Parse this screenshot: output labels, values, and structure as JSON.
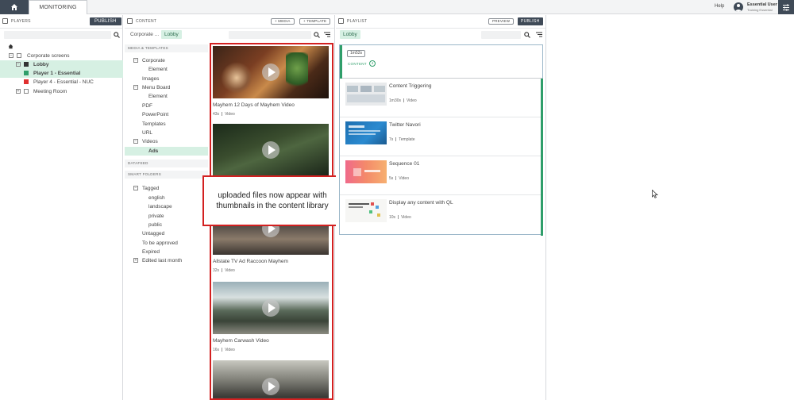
{
  "topbar": {
    "tab_label": "MONITORING",
    "help": "Help",
    "user_name": "Essential User",
    "user_role": "Training Essential"
  },
  "players": {
    "title": "PLAYERS",
    "publish": "PUBLISH",
    "tree": [
      {
        "label": "Corporate screens",
        "bold": false
      },
      {
        "label": "Lobby",
        "bold": true
      },
      {
        "label": "Player 1 - Essential",
        "bold": true
      },
      {
        "label": "Player 4 - Essential - NUC",
        "bold": false
      },
      {
        "label": "Meeting Room",
        "bold": false
      }
    ]
  },
  "content": {
    "title": "CONTENT",
    "add_media": "+ MEDIA",
    "add_template": "+ TEMPLATE",
    "breadcrumb": "Corporate ...",
    "breadcrumb_chip": "Lobby",
    "sections": {
      "media_templates": "MEDIA & TEMPLATES",
      "datafeed": "DATAFEED",
      "smart_folders": "SMART FOLDERS"
    },
    "folders": [
      "Corporate",
      "Element",
      "Images",
      "Menu Board",
      "Element",
      "PDF",
      "PowerPoint",
      "Templates",
      "URL",
      "Videos",
      "Ads"
    ],
    "smart": [
      "Tagged",
      "english",
      "landscape",
      "private",
      "public",
      "Untagged",
      "To be approved",
      "Expired",
      "Edited last month"
    ],
    "media": [
      {
        "title": "Mayhem 12 Days of Mayhem Video",
        "duration": "43s",
        "type": "Video"
      },
      {
        "title": "",
        "duration": "",
        "type": ""
      },
      {
        "title": "Allstate TV Ad Raccoon Mayhem",
        "duration": "32s",
        "type": "Video"
      },
      {
        "title": "Mayhem Carwash Video",
        "duration": "16s",
        "type": "Video"
      },
      {
        "title": "",
        "duration": "",
        "type": ""
      }
    ],
    "callout": "uploaded files now appear with thumbnails in the content library"
  },
  "playlist": {
    "title": "PLAYLIST",
    "preview": "PREVIEW",
    "publish": "PUBLISH",
    "chip": "Lobby",
    "duration": "1m52s",
    "content_label": "CONTENT",
    "content_count": "4",
    "items": [
      {
        "title": "Content Triggering",
        "duration": "1m30s",
        "type": "Video"
      },
      {
        "title": "Twitter Navori",
        "duration": "7s",
        "type": "Template"
      },
      {
        "title": "Sequence 01",
        "duration": "5s",
        "type": "Video"
      },
      {
        "title": "Display any content with QL",
        "duration": "10s",
        "type": "Video"
      }
    ]
  },
  "colors": {
    "accent_green": "#2f9e6a",
    "selected_bg": "#d6f0e3",
    "dark_button": "#3f4a57",
    "annotation_red": "#d32020"
  },
  "icons": [
    "home-icon",
    "user-avatar-icon",
    "settings-sliders-icon",
    "search-icon",
    "filter-icon",
    "play-icon",
    "cursor-icon"
  ]
}
